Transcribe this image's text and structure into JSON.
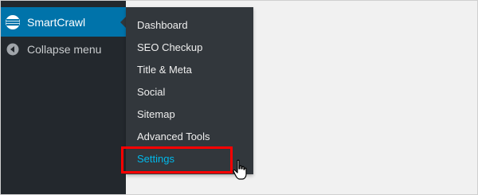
{
  "sidebar": {
    "plugin_label": "SmartCrawl",
    "plugin_icon": "smartcrawl-icon",
    "collapse_label": "Collapse menu",
    "collapse_icon": "collapse-arrow-left-icon"
  },
  "submenu": {
    "items": [
      {
        "label": "Dashboard"
      },
      {
        "label": "SEO Checkup"
      },
      {
        "label": "Title & Meta"
      },
      {
        "label": "Social"
      },
      {
        "label": "Sitemap"
      },
      {
        "label": "Advanced Tools"
      },
      {
        "label": "Settings",
        "active": true
      }
    ]
  },
  "annotation": {
    "highlight_color": "#ff0000",
    "cursor_icon": "hand-pointer-icon"
  },
  "colors": {
    "sidebar_bg": "#23282d",
    "submenu_bg": "#32373c",
    "current_bg": "#0073aa",
    "active_text": "#00b9eb",
    "page_bg": "#f1f1f1"
  }
}
